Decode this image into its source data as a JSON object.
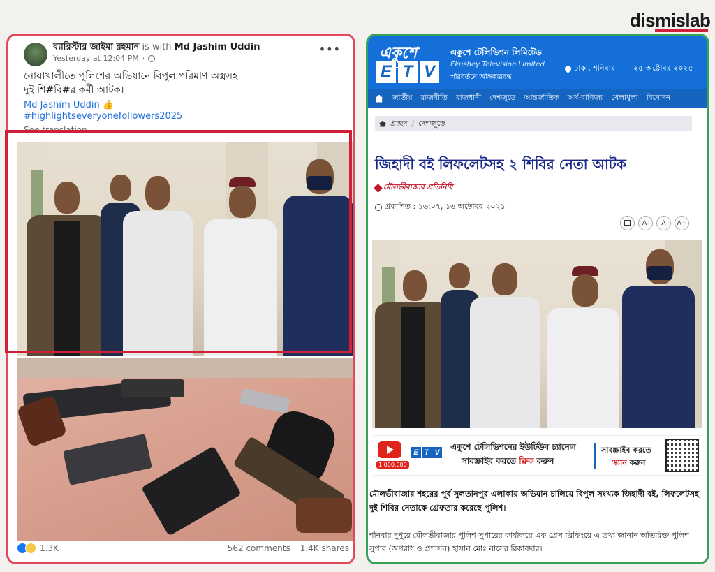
{
  "brand": {
    "logo": "dismislab",
    "accent": "#d0213a"
  },
  "facebook": {
    "author": "ব্যারিস্টার জাইমা রহমান",
    "with_text": "is with",
    "tagged": "Md Jashim Uddin",
    "timestamp": "Yesterday at 12:04 PM",
    "visibility_icon": "globe-icon",
    "menu_icon": "more-dots-icon",
    "post_line1": "নোয়াখালীতে পুলিশের অভিযানে বিপুল পরিমাণ অস্ত্রসহ",
    "post_line2": "দুই শি#বি#র কর্মী আটক।",
    "mention": "Md Jashim Uddin 👍",
    "hashtag": "#highlightseveryonefollowers2025",
    "see_translation": "See translation",
    "reactions_count": "1.3K",
    "comments": "562 comments",
    "shares": "1.4K shares",
    "highlight_color": "#d11f3a"
  },
  "etv": {
    "logo_bn": "একুশে",
    "logo_letters": [
      "E",
      "T",
      "V"
    ],
    "name_bn": "একুশে টেলিভিশন লিমিটেড",
    "name_en": "Ekushey Television Limited",
    "tagline": "পরিবর্তনে অঙ্গিকারবদ্ধ",
    "location": "ঢাকা, শনিবার",
    "date": "২৫ অক্টোবর ২০২৫",
    "nav": [
      "জাতীয়",
      "রাজনীতি",
      "রাজধানী",
      "দেশজুড়ে",
      "আন্তর্জাতিক",
      "অর্থ-বাণিজ্য",
      "খেলাধুলা",
      "বিনোদন"
    ],
    "crumb_home": "প্রচ্ছদ",
    "crumb_section": "দেশজুড়ে",
    "headline": "জিহাদী বই লিফলেটসহ ২ শিবির নেতা আটক",
    "reporter": "মৌলভীবাজার প্রতিনিধি",
    "published_label": "প্রকাশিত : ১৬:০৭, ১৬ অক্টোবর ২০২১",
    "font_tools": [
      "A-",
      "A",
      "A+"
    ],
    "banner": {
      "line1": "একুশে টেলিভিশনের ইউটিউব চ্যানেল",
      "line2_prefix": "সাবস্ক্রাইব করতে ",
      "line2_red": "ক্লিক",
      "line2_suffix": " করুন",
      "line3": "সাবস্ক্রাইব করতে",
      "line4_red": "স্ক্যান",
      "line4_suffix": " করুন",
      "yt_count": "1,000,000"
    },
    "body1": "মৌলভীবাজার শহরের পূর্ব সুলতানপুর এলাকায় অভিযান চালিয়ে বিপুল সংখ্যক জিহাদী বই, লিফলেটসহ দুই শিবির নেতাকে গ্রেফতার করেছে পুলিশ।",
    "body2": "শনিবার দুপুরে মৌলভীবাজার পুলিশ সুপারের কার্যালয়ে এক প্রেস ব্রিফিংয়ে এ তথ্য জানান অতিরিক্ত পুলিশ সুপার (অপরাধ ও প্রশাসন) হাসান মোঃ নাসের রিকাবদার।",
    "header_color": "#1470d8",
    "frame_color": "#36a25a"
  }
}
